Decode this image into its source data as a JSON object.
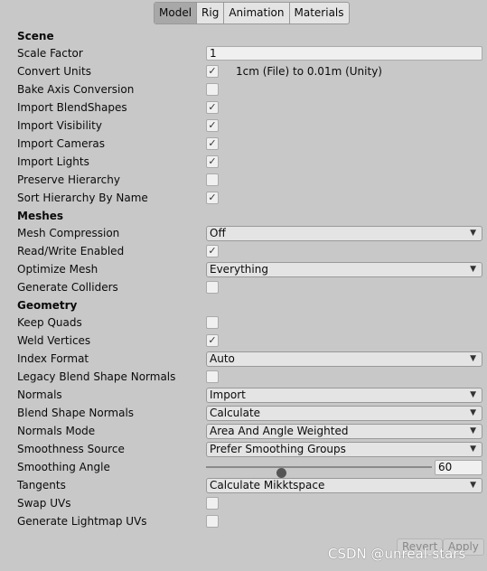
{
  "tabs": [
    {
      "label": "Model",
      "active": true
    },
    {
      "label": "Rig"
    },
    {
      "label": "Animation"
    },
    {
      "label": "Materials"
    }
  ],
  "sections": [
    {
      "header": "Scene",
      "rows": [
        {
          "label": "Scale Factor",
          "type": "text",
          "value": "1"
        },
        {
          "label": "Convert Units",
          "type": "checkbox",
          "checked": true,
          "note": "1cm (File) to 0.01m (Unity)"
        },
        {
          "label": "Bake Axis Conversion",
          "type": "checkbox",
          "checked": false
        },
        {
          "label": "Import BlendShapes",
          "type": "checkbox",
          "checked": true
        },
        {
          "label": "Import Visibility",
          "type": "checkbox",
          "checked": true
        },
        {
          "label": "Import Cameras",
          "type": "checkbox",
          "checked": true
        },
        {
          "label": "Import Lights",
          "type": "checkbox",
          "checked": true
        },
        {
          "label": "Preserve Hierarchy",
          "type": "checkbox",
          "checked": false
        },
        {
          "label": "Sort Hierarchy By Name",
          "type": "checkbox",
          "checked": true
        }
      ]
    },
    {
      "header": "Meshes",
      "rows": [
        {
          "label": "Mesh Compression",
          "type": "dropdown",
          "value": "Off"
        },
        {
          "label": "Read/Write Enabled",
          "type": "checkbox",
          "checked": true
        },
        {
          "label": "Optimize Mesh",
          "type": "dropdown",
          "value": "Everything"
        },
        {
          "label": "Generate Colliders",
          "type": "checkbox",
          "checked": false
        }
      ]
    },
    {
      "header": "Geometry",
      "rows": [
        {
          "label": "Keep Quads",
          "type": "checkbox",
          "checked": false
        },
        {
          "label": "Weld Vertices",
          "type": "checkbox",
          "checked": true
        },
        {
          "label": "Index Format",
          "type": "dropdown",
          "value": "Auto"
        },
        {
          "label": "Legacy Blend Shape Normals",
          "type": "checkbox",
          "checked": false
        },
        {
          "label": "Normals",
          "type": "dropdown",
          "value": "Import"
        },
        {
          "label": "Blend Shape Normals",
          "type": "dropdown",
          "value": "Calculate"
        },
        {
          "label": "Normals Mode",
          "type": "dropdown",
          "value": "Area And Angle Weighted"
        },
        {
          "label": "Smoothness Source",
          "type": "dropdown",
          "value": "Prefer Smoothing Groups"
        },
        {
          "label": "Smoothing Angle",
          "type": "slider",
          "value": "60",
          "min": 0,
          "max": 180
        },
        {
          "label": "Tangents",
          "type": "dropdown",
          "value": "Calculate Mikktspace"
        },
        {
          "label": "Swap UVs",
          "type": "checkbox",
          "checked": false
        },
        {
          "label": "Generate Lightmap UVs",
          "type": "checkbox",
          "checked": false
        }
      ]
    }
  ],
  "buttons": {
    "revert": "Revert",
    "apply": "Apply"
  },
  "watermark": "CSDN @unreal-stars"
}
